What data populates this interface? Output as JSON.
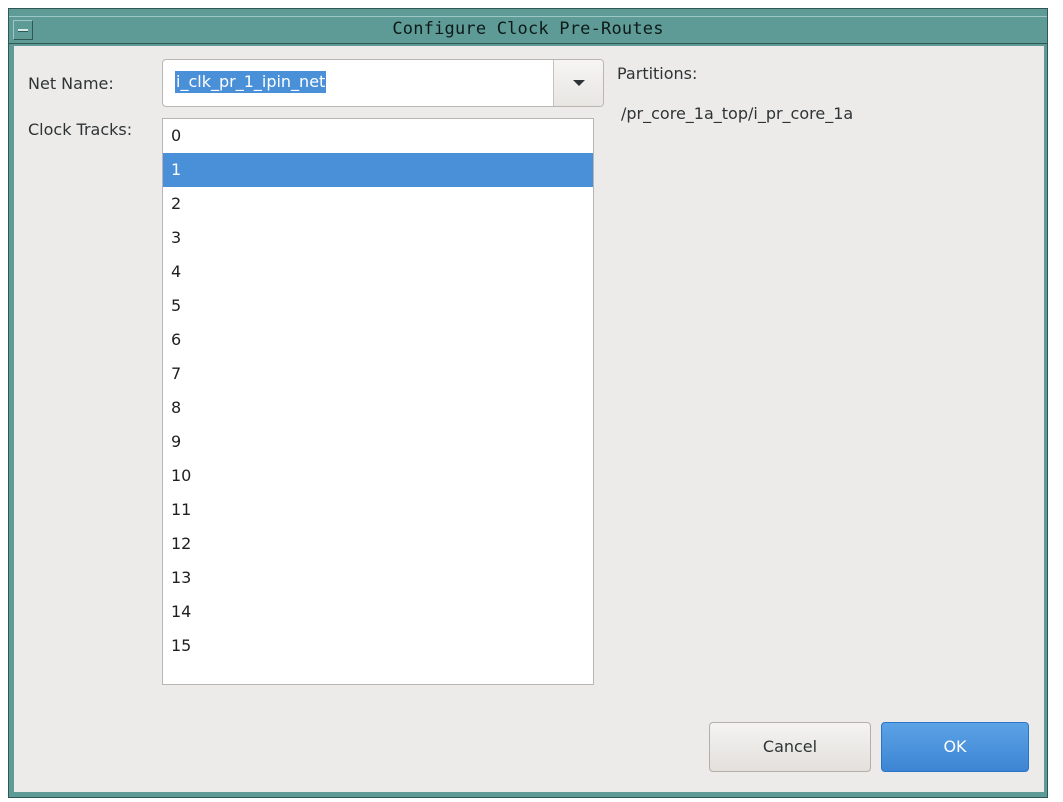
{
  "window": {
    "title": "Configure Clock Pre-Routes"
  },
  "form": {
    "net_name_label": "Net Name:",
    "net_name_value": "i_clk_pr_1_ipin_net",
    "clock_tracks_label": "Clock Tracks:",
    "partitions_label": "Partitions:",
    "partition_path": "/pr_core_1a_top/i_pr_core_1a"
  },
  "clock_tracks": {
    "items": [
      "0",
      "1",
      "2",
      "3",
      "4",
      "5",
      "6",
      "7",
      "8",
      "9",
      "10",
      "11",
      "12",
      "13",
      "14",
      "15"
    ],
    "selected": "1"
  },
  "buttons": {
    "cancel": "Cancel",
    "ok": "OK"
  },
  "colors": {
    "titlebar": "#5f9b96",
    "selection": "#4a90d9",
    "dialog_bg": "#edebe9"
  },
  "icons": {
    "window_menu": "window-menu-icon",
    "dropdown": "chevron-down-icon"
  }
}
